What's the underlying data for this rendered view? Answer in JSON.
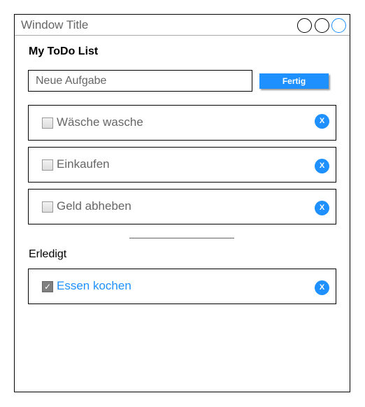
{
  "window": {
    "title": "Window Title",
    "accent_color": "#1e90ff"
  },
  "app": {
    "title": "My ToDo List",
    "new_task": {
      "placeholder": "Neue Aufgabe",
      "value": ""
    },
    "done_button_label": "Fertig"
  },
  "open_tasks": [
    {
      "label": "Wäsche wasche",
      "checked": false,
      "delete_label": "X"
    },
    {
      "label": "Einkaufen",
      "checked": false,
      "delete_label": "X"
    },
    {
      "label": "Geld abheben",
      "checked": false,
      "delete_label": "X"
    }
  ],
  "completed_section": {
    "title": "Erledigt",
    "tasks": [
      {
        "label": "Essen kochen",
        "checked": true,
        "delete_label": "X",
        "check_glyph": "✓"
      }
    ]
  }
}
